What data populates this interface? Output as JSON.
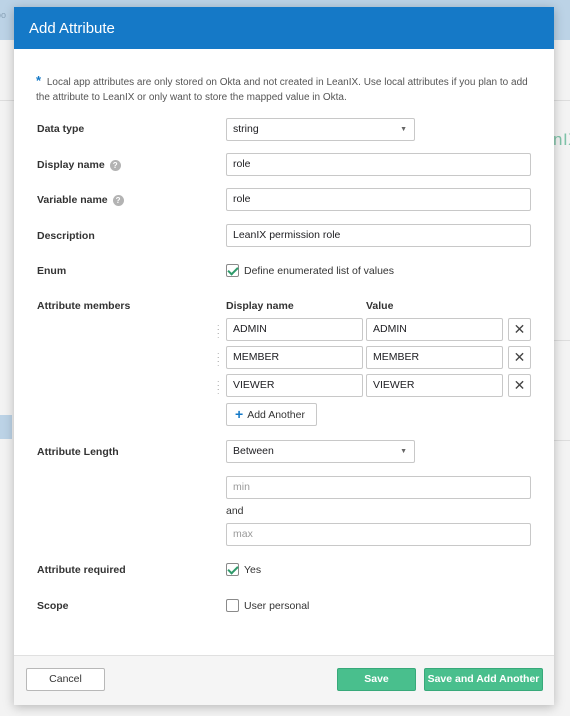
{
  "background": {
    "breadcrumb_fragment": "oo",
    "right_text_fragment": "nIX"
  },
  "modal": {
    "title": "Add Attribute",
    "info_text": "Local app attributes are only stored on Okta and not created in LeanIX. Use local attributes if you plan to add the attribute to LeanIX or only want to store the mapped value in Okta."
  },
  "form": {
    "data_type": {
      "label": "Data type",
      "value": "string"
    },
    "display_name": {
      "label": "Display name",
      "value": "role"
    },
    "variable_name": {
      "label": "Variable name",
      "value": "role"
    },
    "description": {
      "label": "Description",
      "value": "LeanIX permission role"
    },
    "enum": {
      "label": "Enum",
      "checkbox_label": "Define enumerated list of values",
      "checked": true
    },
    "attribute_members": {
      "label": "Attribute members",
      "col_display_name": "Display name",
      "col_value": "Value",
      "rows": [
        {
          "display_name": "ADMIN",
          "value": "ADMIN"
        },
        {
          "display_name": "MEMBER",
          "value": "MEMBER"
        },
        {
          "display_name": "VIEWER",
          "value": "VIEWER"
        }
      ],
      "add_another_label": "Add Another"
    },
    "attribute_length": {
      "label": "Attribute Length",
      "value": "Between",
      "min_placeholder": "min",
      "and_text": "and",
      "max_placeholder": "max"
    },
    "attribute_required": {
      "label": "Attribute required",
      "checkbox_label": "Yes",
      "checked": true
    },
    "scope": {
      "label": "Scope",
      "checkbox_label": "User personal",
      "checked": false
    }
  },
  "footer": {
    "cancel_label": "Cancel",
    "save_label": "Save",
    "save_add_label": "Save and Add Another"
  },
  "colors": {
    "header": "#1579c7",
    "primary_button": "#49bf8d",
    "check": "#2e9a6a"
  }
}
